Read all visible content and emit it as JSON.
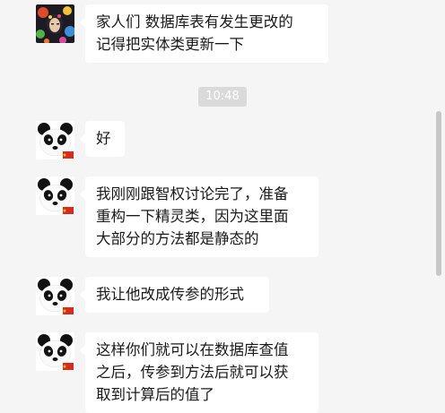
{
  "colors": {
    "chat_background": "#f5f5f5",
    "bubble_background": "#ffffff",
    "bubble_text": "#1a1a1a",
    "timestamp_background": "#dadada",
    "timestamp_text": "#ffffff",
    "scrollbar": "#c7c7c7"
  },
  "timestamp": "10:48",
  "messages": [
    {
      "sender_avatar": "colorful-portrait-avatar",
      "lines": [
        "家人们 数据库表有发生更改的",
        "记得把实体类更新一下"
      ]
    },
    {
      "sender_avatar": "panda-avatar",
      "lines": [
        "好"
      ]
    },
    {
      "sender_avatar": "panda-avatar",
      "lines": [
        "我刚刚跟智权讨论完了，准备",
        "重构一下精灵类，因为这里面",
        "大部分的方法都是静态的"
      ]
    },
    {
      "sender_avatar": "panda-avatar",
      "lines": [
        "我让他改成传参的形式"
      ]
    },
    {
      "sender_avatar": "panda-avatar",
      "lines": [
        "这样你们就可以在数据库查值",
        "之后，传参到方法后就可以获",
        "取到计算后的值了"
      ]
    }
  ]
}
